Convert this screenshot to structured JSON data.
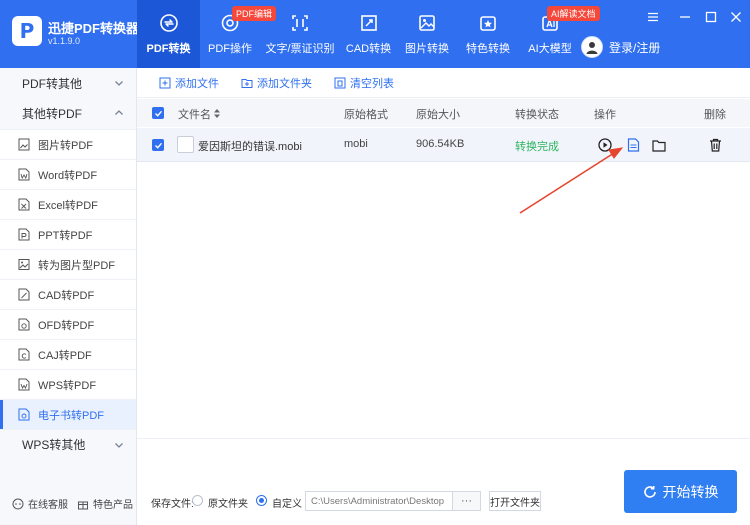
{
  "app": {
    "name": "迅捷PDF转换器",
    "version": "v1.1.9.0",
    "logo_letter": "P"
  },
  "nav": {
    "tabs": [
      {
        "label": "PDF转换",
        "icon": "convert-icon",
        "active": true
      },
      {
        "label": "PDF操作",
        "icon": "gear-icon",
        "badge": "PDF编辑"
      },
      {
        "label": "文字/票证识别",
        "icon": "scan-text-icon"
      },
      {
        "label": "CAD转换",
        "icon": "cad-icon"
      },
      {
        "label": "图片转换",
        "icon": "image-icon"
      },
      {
        "label": "特色转换",
        "icon": "star-icon"
      },
      {
        "label": "AI大模型",
        "icon": "ai-icon",
        "badge": "AI解读文档"
      }
    ]
  },
  "user": {
    "login_label": "登录/注册"
  },
  "sidebar": {
    "sections": [
      {
        "label": "PDF转其他",
        "expanded": false
      },
      {
        "label": "其他转PDF",
        "expanded": true
      },
      {
        "label": "WPS转其他",
        "expanded": false
      }
    ],
    "items": [
      {
        "label": "图片转PDF",
        "icon": "image-file-icon"
      },
      {
        "label": "Word转PDF",
        "icon": "word-file-icon"
      },
      {
        "label": "Excel转PDF",
        "icon": "excel-file-icon"
      },
      {
        "label": "PPT转PDF",
        "icon": "ppt-file-icon"
      },
      {
        "label": "转为图片型PDF",
        "icon": "image-pdf-icon"
      },
      {
        "label": "CAD转PDF",
        "icon": "cad-file-icon"
      },
      {
        "label": "OFD转PDF",
        "icon": "ofd-file-icon"
      },
      {
        "label": "CAJ转PDF",
        "icon": "caj-file-icon"
      },
      {
        "label": "WPS转PDF",
        "icon": "wps-file-icon"
      },
      {
        "label": "电子书转PDF",
        "icon": "ebook-file-icon",
        "active": true
      }
    ],
    "bottom": {
      "service": "在线客服",
      "products": "特色产品"
    }
  },
  "toolbar": {
    "add_file": "添加文件",
    "add_folder": "添加文件夹",
    "clear_list": "清空列表"
  },
  "table": {
    "columns": {
      "name": "文件名",
      "format": "原始格式",
      "size": "原始大小",
      "status": "转换状态",
      "actions": "操作",
      "delete": "删除"
    },
    "rows": [
      {
        "name": "爱因斯坦的错误.mobi",
        "format": "mobi",
        "size": "906.54KB",
        "status": "转换完成",
        "checked": true
      }
    ]
  },
  "footer": {
    "save_label": "保存文件:",
    "option_original": "原文件夹",
    "option_custom": "自定义",
    "path_value": "C:\\Users\\Administrator\\Desktop",
    "browse_label": "···",
    "open_folder": "打开文件夹",
    "start_label": "开始转换"
  },
  "colors": {
    "primary": "#2f6ff0",
    "status_done": "#2eb35f",
    "badge": "#f5473a",
    "arrow": "#e5452e"
  }
}
